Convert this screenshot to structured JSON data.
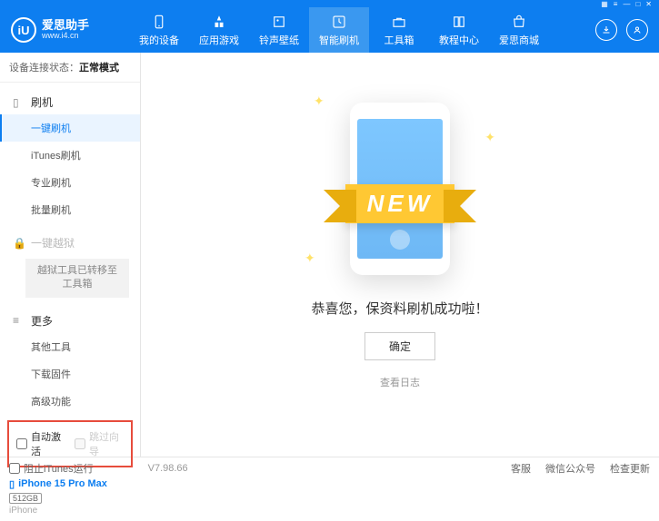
{
  "titlebar": {
    "icons": [
      "▦",
      "≡",
      "—",
      "□",
      "✕"
    ]
  },
  "header": {
    "logo": {
      "mark": "iU",
      "title": "爱思助手",
      "subtitle": "www.i4.cn"
    },
    "nav": [
      {
        "label": "我的设备"
      },
      {
        "label": "应用游戏"
      },
      {
        "label": "铃声壁纸"
      },
      {
        "label": "智能刷机"
      },
      {
        "label": "工具箱"
      },
      {
        "label": "教程中心"
      },
      {
        "label": "爱思商城"
      }
    ]
  },
  "sidebar": {
    "conn_prefix": "设备连接状态：",
    "conn_status": "正常模式",
    "sections": {
      "flash": {
        "title": "刷机",
        "items": [
          "一键刷机",
          "iTunes刷机",
          "专业刷机",
          "批量刷机"
        ]
      },
      "jailbreak": {
        "title": "一键越狱",
        "note": "越狱工具已转移至工具箱"
      },
      "more": {
        "title": "更多",
        "items": [
          "其他工具",
          "下载固件",
          "高级功能"
        ]
      }
    },
    "checkboxes": {
      "auto_activate": "自动激活",
      "skip_guide": "跳过向导"
    },
    "device": {
      "name": "iPhone 15 Pro Max",
      "storage": "512GB",
      "type": "iPhone"
    }
  },
  "main": {
    "new_label": "NEW",
    "success": "恭喜您，保资料刷机成功啦！",
    "confirm": "确定",
    "view_log": "查看日志"
  },
  "footer": {
    "block_itunes": "阻止iTunes运行",
    "version": "V7.98.66",
    "links": [
      "客服",
      "微信公众号",
      "检查更新"
    ]
  }
}
